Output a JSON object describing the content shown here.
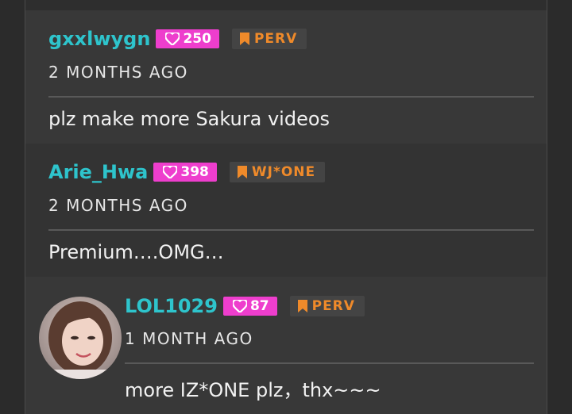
{
  "comments": [
    {
      "username": "gxxlwygn",
      "likes": "250",
      "badge": "PERV",
      "time": "2 MONTHS AGO",
      "text": "plz make more Sakura videos"
    },
    {
      "username": "Arie_Hwa",
      "likes": "398",
      "badge": "WJ*ONE",
      "time": "2 MONTHS AGO",
      "text": "Premium….OMG…"
    },
    {
      "username": "LOL1029",
      "likes": "87",
      "badge": "PERV",
      "time": "1 MONTH AGO",
      "text": "more IZ*ONE plz，thx~~~"
    }
  ],
  "icons": {
    "likes": "heart-icon",
    "badge": "bookmark-icon"
  },
  "colors": {
    "username": "#2ec4cc",
    "likes_badge": "#ee3ecd",
    "rank_badge_text": "#ef8a2a",
    "background": "#383838"
  }
}
